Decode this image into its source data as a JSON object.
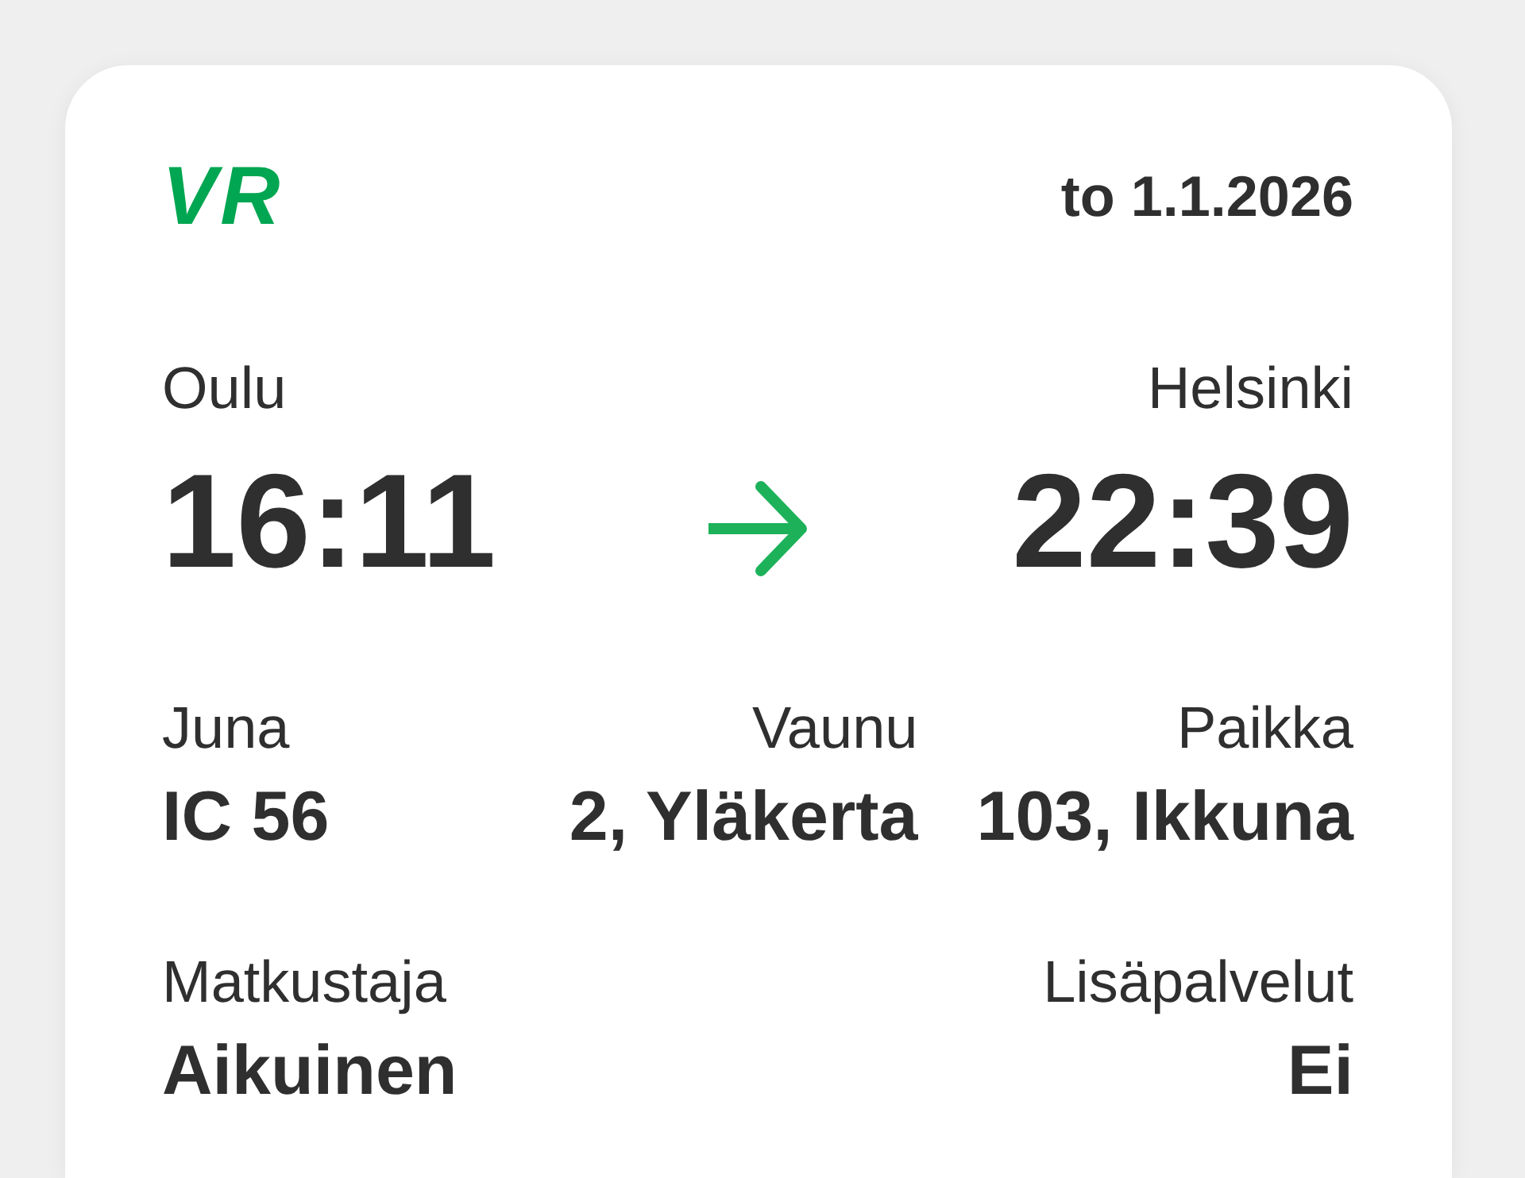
{
  "header": {
    "logo": "VR",
    "date": "to 1.1.2026"
  },
  "route": {
    "from": {
      "station": "Oulu",
      "time": "16:11"
    },
    "to": {
      "station": "Helsinki",
      "time": "22:39"
    }
  },
  "detail_rows": [
    {
      "fields": [
        {
          "label": "Juna",
          "value": "IC 56"
        },
        {
          "label": "Vaunu",
          "value": "2, Yläkerta"
        },
        {
          "label": "Paikka",
          "value": "103, Ikkuna"
        }
      ]
    },
    {
      "fields": [
        {
          "label": "Matkustaja",
          "value": "Aikuinen"
        },
        {
          "label": "Lisäpalvelut",
          "value": "Ei"
        }
      ]
    }
  ]
}
